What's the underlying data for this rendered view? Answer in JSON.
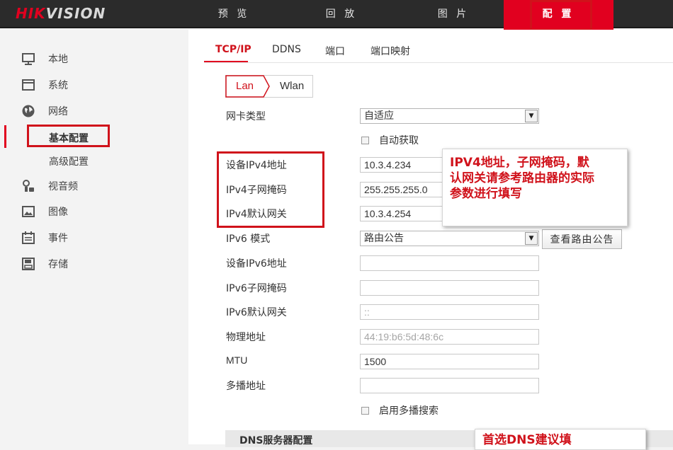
{
  "brand": {
    "logo_part1": "HIK",
    "logo_part2": "VISION"
  },
  "topnav": {
    "tabs": [
      {
        "label": "预 览"
      },
      {
        "label": "回 放"
      },
      {
        "label": "图 片"
      },
      {
        "label": "配 置"
      }
    ],
    "active": "配 置"
  },
  "sidebar": {
    "items": [
      {
        "label": "本地",
        "icon": "monitor-icon"
      },
      {
        "label": "系统",
        "icon": "window-icon"
      },
      {
        "label": "网络",
        "icon": "globe-icon"
      },
      {
        "label": "视音频",
        "icon": "mic-camera-icon"
      },
      {
        "label": "图像",
        "icon": "image-icon"
      },
      {
        "label": "事件",
        "icon": "calendar-icon"
      },
      {
        "label": "存储",
        "icon": "disk-icon"
      }
    ],
    "network_sub": [
      "基本配置",
      "高级配置"
    ],
    "active_sub": "基本配置"
  },
  "subtabs": [
    "TCP/IP",
    "DDNS",
    "端口",
    "端口映射"
  ],
  "lan_wlan": {
    "lan": "Lan",
    "wlan": "Wlan"
  },
  "form": {
    "nic_type": {
      "label": "网卡类型",
      "value": "自适应"
    },
    "dhcp": {
      "label": "自动获取"
    },
    "ipv4_addr": {
      "label": "设备IPv4地址",
      "value": "10.3.4.234"
    },
    "ipv4_mask": {
      "label": "IPv4子网掩码",
      "value": "255.255.255.0"
    },
    "ipv4_gw": {
      "label": "IPv4默认网关",
      "value": "10.3.4.254"
    },
    "ipv6_mode": {
      "label": "IPv6 模式",
      "value": "路由公告",
      "button": "查看路由公告"
    },
    "ipv6_addr": {
      "label": "设备IPv6地址",
      "value": ""
    },
    "ipv6_mask": {
      "label": "IPv6子网掩码",
      "value": ""
    },
    "ipv6_gw": {
      "label": "IPv6默认网关",
      "value": "::"
    },
    "mac": {
      "label": "物理地址",
      "value": "44:19:b6:5d:48:6c"
    },
    "mtu": {
      "label": "MTU",
      "value": "1500"
    },
    "multicast": {
      "label": "多播地址",
      "value": ""
    },
    "multicast_search": {
      "label": "启用多播搜索"
    },
    "dns_section": "DNS服务器配置"
  },
  "callouts": {
    "ipv4": [
      "IPV4地址，子网掩码，默",
      "认网关请参考路由器的实际",
      "参数进行填写"
    ],
    "dns": "首选DNS建议填"
  },
  "colors": {
    "accent": "#e1001f",
    "topbar": "#2b2b2b",
    "annotation": "#d0121b"
  }
}
